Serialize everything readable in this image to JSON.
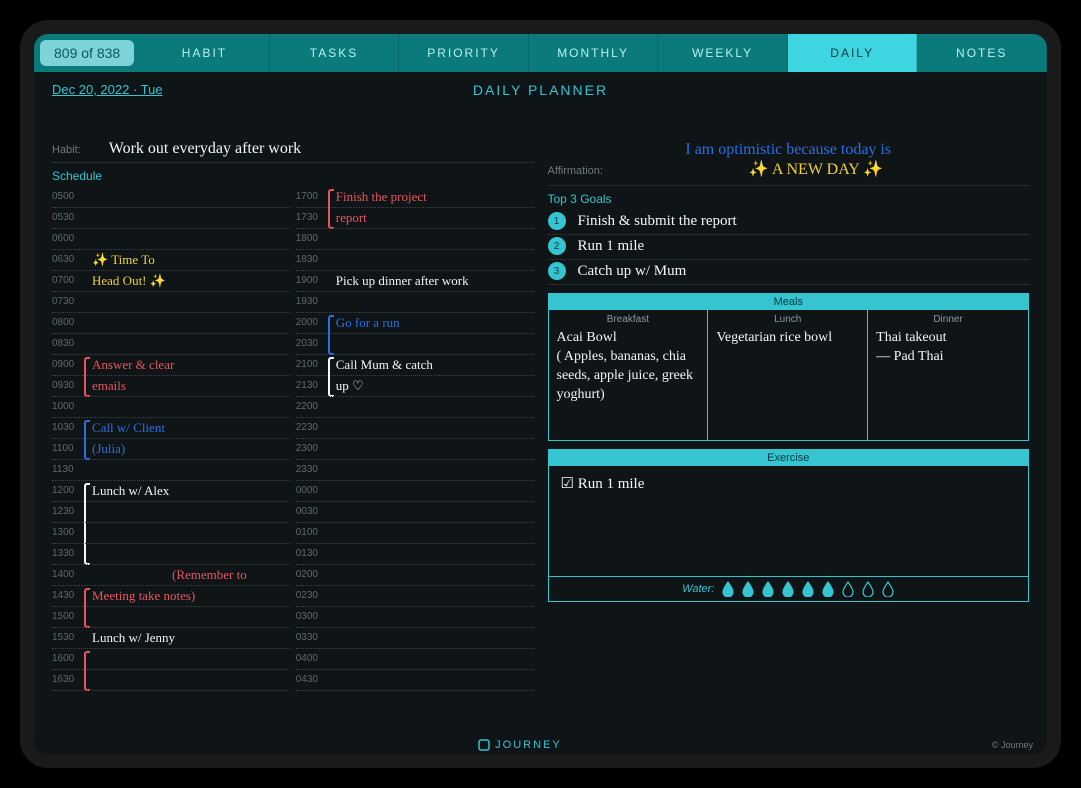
{
  "pageCounter": "809 of 838",
  "tabs": [
    "HABIT",
    "TASKS",
    "PRIORITY",
    "MONTHLY",
    "WEEKLY",
    "DAILY",
    "NOTES"
  ],
  "activeTab": "DAILY",
  "date": "Dec 20, 2022 · Tue",
  "title": "DAILY PLANNER",
  "habitLabel": "Habit:",
  "habitText": "Work out everyday after work",
  "affirmLabel": "Affirmation:",
  "affirmLine1": "I am optimistic because today is",
  "affirmLine2": "✨ A NEW DAY ✨",
  "scheduleLabel": "Schedule",
  "scheduleLeft": [
    {
      "t": "0500"
    },
    {
      "t": "0530"
    },
    {
      "t": "0600"
    },
    {
      "t": "0630",
      "text": "✨ Time To",
      "cls": "hand-yellow"
    },
    {
      "t": "0700",
      "text": "Head Out! ✨",
      "cls": "hand-yellow"
    },
    {
      "t": "0730"
    },
    {
      "t": "0800"
    },
    {
      "t": "0830"
    },
    {
      "t": "0900",
      "text": "Answer & clear",
      "cls": "hand-red",
      "br": "br-red"
    },
    {
      "t": "0930",
      "text": "emails",
      "cls": "hand-red"
    },
    {
      "t": "1000"
    },
    {
      "t": "1030",
      "text": "Call w/ Client",
      "cls": "hand-blue",
      "br": "br-blue"
    },
    {
      "t": "1100",
      "text": "(Julia)",
      "cls": "hand-blue"
    },
    {
      "t": "1130"
    },
    {
      "t": "1200",
      "text": "Lunch w/ Alex",
      "cls": "hand",
      "br": "br-white",
      "brh": "82"
    },
    {
      "t": "1230"
    },
    {
      "t": "1300"
    },
    {
      "t": "1330"
    },
    {
      "t": "1400",
      "text": "(Remember to",
      "cls": "hand-red",
      "off": "120"
    },
    {
      "t": "1430",
      "text": "Meeting   take notes)",
      "cls": "hand-red",
      "br": "br-red"
    },
    {
      "t": "1500"
    },
    {
      "t": "1530",
      "text": "Lunch w/ Jenny",
      "cls": "hand"
    },
    {
      "t": "1600",
      "br": "br-red"
    },
    {
      "t": "1630"
    }
  ],
  "scheduleRight": [
    {
      "t": "1700",
      "text": "Finish the project",
      "cls": "hand-red",
      "br": "br-red"
    },
    {
      "t": "1730",
      "text": "report",
      "cls": "hand-red"
    },
    {
      "t": "1800"
    },
    {
      "t": "1830"
    },
    {
      "t": "1900",
      "text": "Pick up dinner after work",
      "cls": "hand"
    },
    {
      "t": "1930"
    },
    {
      "t": "2000",
      "text": "Go for a run",
      "cls": "hand-blue",
      "br": "br-blue"
    },
    {
      "t": "2030"
    },
    {
      "t": "2100",
      "text": "Call Mum & catch",
      "cls": "hand",
      "br": "br-white"
    },
    {
      "t": "2130",
      "text": "up ♡",
      "cls": "hand"
    },
    {
      "t": "2200"
    },
    {
      "t": "2230"
    },
    {
      "t": "2300"
    },
    {
      "t": "2330"
    },
    {
      "t": "0000"
    },
    {
      "t": "0030"
    },
    {
      "t": "0100"
    },
    {
      "t": "0130"
    },
    {
      "t": "0200"
    },
    {
      "t": "0230"
    },
    {
      "t": "0300"
    },
    {
      "t": "0330"
    },
    {
      "t": "0400"
    },
    {
      "t": "0430"
    }
  ],
  "goalsLabel": "Top 3 Goals",
  "goals": [
    "Finish & submit the report",
    "Run 1 mile",
    "Catch up w/ Mum"
  ],
  "mealsLabel": "Meals",
  "meals": {
    "breakfast": {
      "title": "Breakfast",
      "text": "Acai Bowl\n( Apples, bananas, chia seeds, apple juice, greek yoghurt)"
    },
    "lunch": {
      "title": "Lunch",
      "text": "Vegetarian rice bowl"
    },
    "dinner": {
      "title": "Dinner",
      "text": "Thai takeout\n— Pad Thai"
    }
  },
  "exerciseLabel": "Exercise",
  "exerciseText": "☑ Run 1 mile",
  "waterLabel": "Water:",
  "waterFilled": 6,
  "waterTotal": 9,
  "footerBrand": "JOURNEY",
  "footerCopy": "© Journey"
}
